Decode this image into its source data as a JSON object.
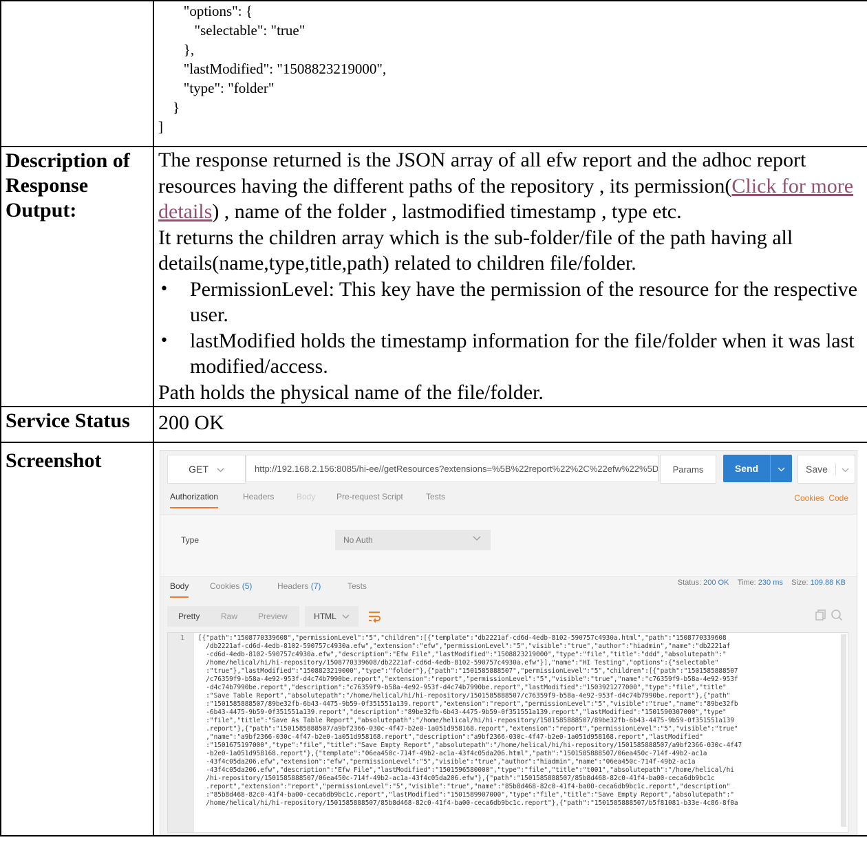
{
  "code_snippet": "       \"options\": {\n          \"selectable\": \"true\"\n       },\n       \"lastModified\": \"1508823219000\",\n       \"type\": \"folder\"\n    }\n]",
  "rows": {
    "description": {
      "label": "Description of Response Output:",
      "intro": "The response returned is the JSON array of all efw report and the adhoc report resources having the different paths of the repository , its permission(",
      "link": "Click for more details",
      "intro_tail": ") , name of the folder , lastmodified timestamp , type etc.",
      "children": "It returns the children array which is the sub-folder/file of the path having all details(name,type,title,path) related to children file/folder.",
      "bullets": [
        "PermissionLevel: This key have the permission of the resource for the respective user.",
        "lastModified holds the timestamp information for the file/folder when it was last modified/access."
      ],
      "path_note": "Path holds the physical name of the file/folder."
    },
    "status": {
      "label": "Service Status",
      "value": "200 OK"
    },
    "screenshot": {
      "label": "Screenshot"
    }
  },
  "client": {
    "method": "GET",
    "url": "http://192.168.2.156:8085/hi-ee//getResources?extensions=%5B%22report%22%2C%22efw%22%5D",
    "params": "Params",
    "send": "Send",
    "save": "Save",
    "request_tabs": [
      "Authorization",
      "Headers",
      "Body",
      "Pre-request Script",
      "Tests"
    ],
    "cookies_link": "Cookies",
    "code_link": "Code",
    "type_label": "Type",
    "type_value": "No Auth",
    "response_tabs": {
      "body": "Body",
      "cookies": "Cookies",
      "cookies_count": "(5)",
      "headers": "Headers",
      "headers_count": "(7)",
      "tests": "Tests"
    },
    "status_label": "Status:",
    "status_value": "200 OK",
    "time_label": "Time:",
    "time_value": "230 ms",
    "size_label": "Size:",
    "size_value": "109.88 KB",
    "view_modes": [
      "Pretty",
      "Raw",
      "Preview"
    ],
    "language": "HTML",
    "line_number": "1",
    "response_body": "[{\"path\":\"1508770339608\",\"permissionLevel\":\"5\",\"children\":[{\"template\":\"db2221af-cd6d-4edb-8102-590757c4930a.html\",\"path\":\"1508770339608\n  /db2221af-cd6d-4edb-8102-590757c4930a.efw\",\"extension\":\"efw\",\"permissionLevel\":\"5\",\"visible\":\"true\",\"author\":\"hiadmin\",\"name\":\"db2221af\n  -cd6d-4edb-8102-590757c4930a.efw\",\"description\":\"Efw File\",\"lastModified\":\"1508823219000\",\"type\":\"file\",\"title\":\"ddd\",\"absolutepath\":\"\n  /home/helical/hi/hi-repository/1508770339608/db2221af-cd6d-4edb-8102-590757c4930a.efw\"}],\"name\":\"HI Testing\",\"options\":{\"selectable\"\n  :\"true\"},\"lastModified\":\"1508823219000\",\"type\":\"folder\"},{\"path\":\"1501585888507\",\"permissionLevel\":\"5\",\"children\":[{\"path\":\"1501585888507\n  /c76359f9-b58a-4e92-953f-d4c74b7990be.report\",\"extension\":\"report\",\"permissionLevel\":\"5\",\"visible\":\"true\",\"name\":\"c76359f9-b58a-4e92-953f\n  -d4c74b7990be.report\",\"description\":\"c76359f9-b58a-4e92-953f-d4c74b7990be.report\",\"lastModified\":\"1503921277000\",\"type\":\"file\",\"title\"\n  :\"Save Table Report\",\"absolutepath\":\"/home/helical/hi/hi-repository/1501585888507/c76359f9-b58a-4e92-953f-d4c74b7990be.report\"},{\"path\"\n  :\"1501585888507/89be32fb-6b43-4475-9b59-0f351551a139.report\",\"extension\":\"report\",\"permissionLevel\":\"5\",\"visible\":\"true\",\"name\":\"89be32fb\n  -6b43-4475-9b59-0f351551a139.report\",\"description\":\"89be32fb-6b43-4475-9b59-0f351551a139.report\",\"lastModified\":\"1501590307000\",\"type\"\n  :\"file\",\"title\":\"Save As Table Report\",\"absolutepath\":\"/home/helical/hi/hi-repository/1501585888507/89be32fb-6b43-4475-9b59-0f351551a139\n  .report\"},{\"path\":\"1501585888507/a9bf2366-030c-4f47-b2e0-1a051d958168.report\",\"extension\":\"report\",\"permissionLevel\":\"5\",\"visible\":\"true\"\n  ,\"name\":\"a9bf2366-030c-4f47-b2e0-1a051d958168.report\",\"description\":\"a9bf2366-030c-4f47-b2e0-1a051d958168.report\",\"lastModified\"\n  :\"1501675197000\",\"type\":\"file\",\"title\":\"Save Empty Report\",\"absolutepath\":\"/home/helical/hi/hi-repository/1501585888507/a9bf2366-030c-4f47\n  -b2e0-1a051d958168.report\"},{\"template\":\"06ea450c-714f-49b2-ac1a-43f4c05da206.html\",\"path\":\"1501585888507/06ea450c-714f-49b2-ac1a\n  -43f4c05da206.efw\",\"extension\":\"efw\",\"permissionLevel\":\"5\",\"visible\":\"true\",\"author\":\"hiadmin\",\"name\":\"06ea450c-714f-49b2-ac1a\n  -43f4c05da206.efw\",\"description\":\"Efw File\",\"lastModified\":\"1501596580000\",\"type\":\"file\",\"title\":\"t001\",\"absolutepath\":\"/home/helical/hi\n  /hi-repository/1501585888507/06ea450c-714f-49b2-ac1a-43f4c05da206.efw\"},{\"path\":\"1501585888507/85b8d468-82c0-41f4-ba00-ceca6db9bc1c\n  .report\",\"extension\":\"report\",\"permissionLevel\":\"5\",\"visible\":\"true\",\"name\":\"85b8d468-82c0-41f4-ba00-ceca6db9bc1c.report\",\"description\"\n  :\"85b8d468-82c0-41f4-ba00-ceca6db9bc1c.report\",\"lastModified\":\"1501589907000\",\"type\":\"file\",\"title\":\"Save Empty Report\",\"absolutepath\":\"\n  /home/helical/hi/hi-repository/1501585888507/85b8d468-82c0-41f4-ba00-ceca6db9bc1c.report\"},{\"path\":\"1501585888507/b5f81081-b33e-4c86-8f0a",
    "colors": {
      "accent": "#f07b22",
      "send": "#2d7fd0",
      "link": "#954F72"
    }
  }
}
